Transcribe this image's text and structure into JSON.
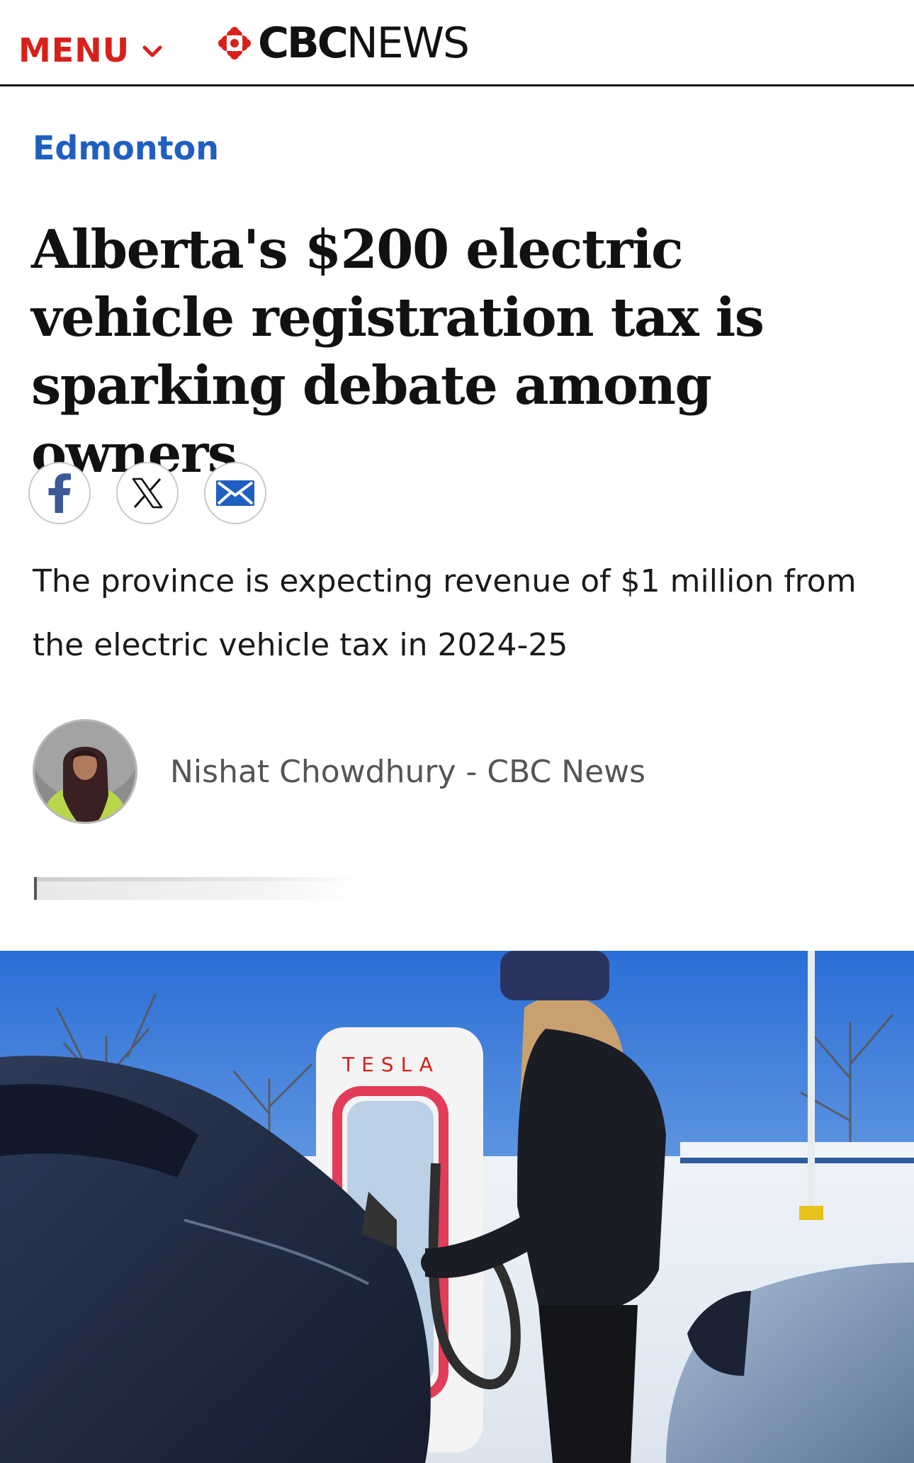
{
  "header": {
    "menu_label": "MENU",
    "logo_cbc": "CBC",
    "logo_news": "NEWS",
    "brand_color": "#d8201a"
  },
  "article": {
    "section": "Edmonton",
    "headline": "Alberta's $200 electric vehicle registration tax is sparking debate among owners",
    "deck": "The province is expecting revenue of $1 million from the electric vehicle tax in 2024-25",
    "byline": "Nishat Chowdhury - CBC News"
  },
  "share": {
    "icons": [
      "facebook-icon",
      "x-icon",
      "email-icon"
    ]
  },
  "hero_image": {
    "charger_brand": "TESLA"
  }
}
